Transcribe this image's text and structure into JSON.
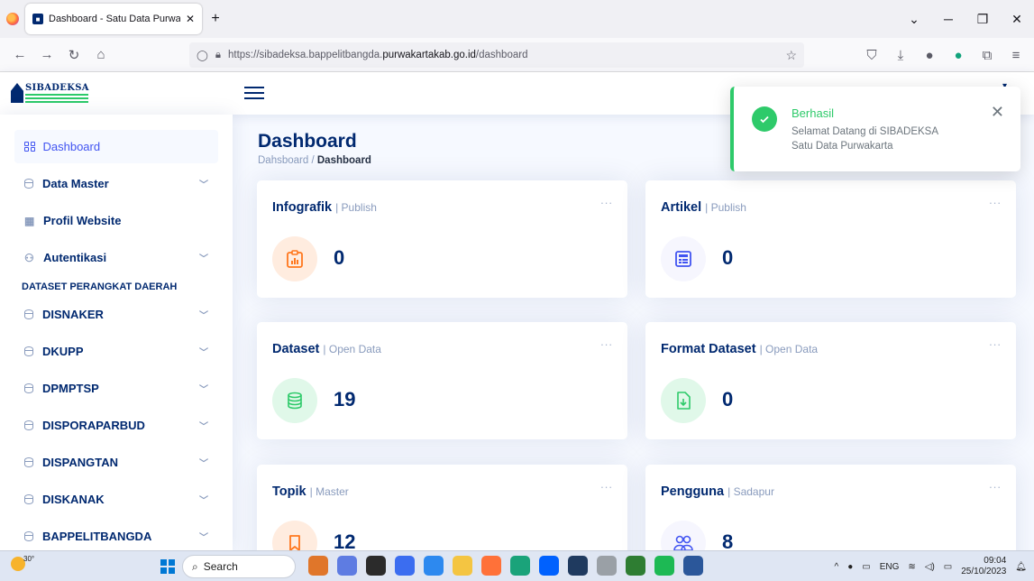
{
  "browser": {
    "tab_title": "Dashboard - Satu Data Purwaka",
    "url_prefix": "https://sibadeksa.bappelitbangda.",
    "url_domain": "purwakartakab.go.id",
    "url_suffix": "/dashboard"
  },
  "header": {
    "logo_text": "SIBADEKSA"
  },
  "sidebar": {
    "items": [
      {
        "label": "Dashboard"
      },
      {
        "label": "Data Master"
      },
      {
        "label": "Profil Website"
      },
      {
        "label": "Autentikasi"
      }
    ],
    "section_heading": "DATASET PERANGKAT DAERAH",
    "datasets": [
      {
        "label": "DISNAKER"
      },
      {
        "label": "DKUPP"
      },
      {
        "label": "DPMPTSP"
      },
      {
        "label": "DISPORAPARBUD"
      },
      {
        "label": "DISPANGTAN"
      },
      {
        "label": "DISKANAK"
      },
      {
        "label": "BAPPELITBANGDA"
      }
    ]
  },
  "main": {
    "title": "Dashboard",
    "breadcrumb_home": "Dahsboard",
    "breadcrumb_sep": "/",
    "breadcrumb_current": "Dashboard",
    "cards": [
      {
        "title": "Infografik",
        "sub": "| Publish",
        "value": "0",
        "icon": "infographic-icon",
        "color": "#ff771d",
        "bg": "#ffecdf"
      },
      {
        "title": "Artikel",
        "sub": "| Publish",
        "value": "0",
        "icon": "article-icon",
        "color": "#4154f1",
        "bg": "#f6f6fe"
      },
      {
        "title": "Dataset",
        "sub": "| Open Data",
        "value": "19",
        "icon": "database-icon",
        "color": "#2eca6a",
        "bg": "#e0f8e9"
      },
      {
        "title": "Format Dataset",
        "sub": "| Open Data",
        "value": "0",
        "icon": "file-download-icon",
        "color": "#2eca6a",
        "bg": "#e0f8e9"
      },
      {
        "title": "Topik",
        "sub": "| Master",
        "value": "12",
        "icon": "bookmark-icon",
        "color": "#ff771d",
        "bg": "#ffecdf"
      },
      {
        "title": "Pengguna",
        "sub": "| Sadapur",
        "value": "8",
        "icon": "people-icon",
        "color": "#4154f1",
        "bg": "#f6f6fe"
      }
    ],
    "dots": "..."
  },
  "toast": {
    "title": "Berhasil",
    "message": "Selamat Datang di SIBADEKSA Satu Data Purwakarta"
  },
  "taskbar": {
    "temp": "30°",
    "search": "Search",
    "lang": "ENG",
    "time": "09:04",
    "date": "25/10/2023"
  }
}
